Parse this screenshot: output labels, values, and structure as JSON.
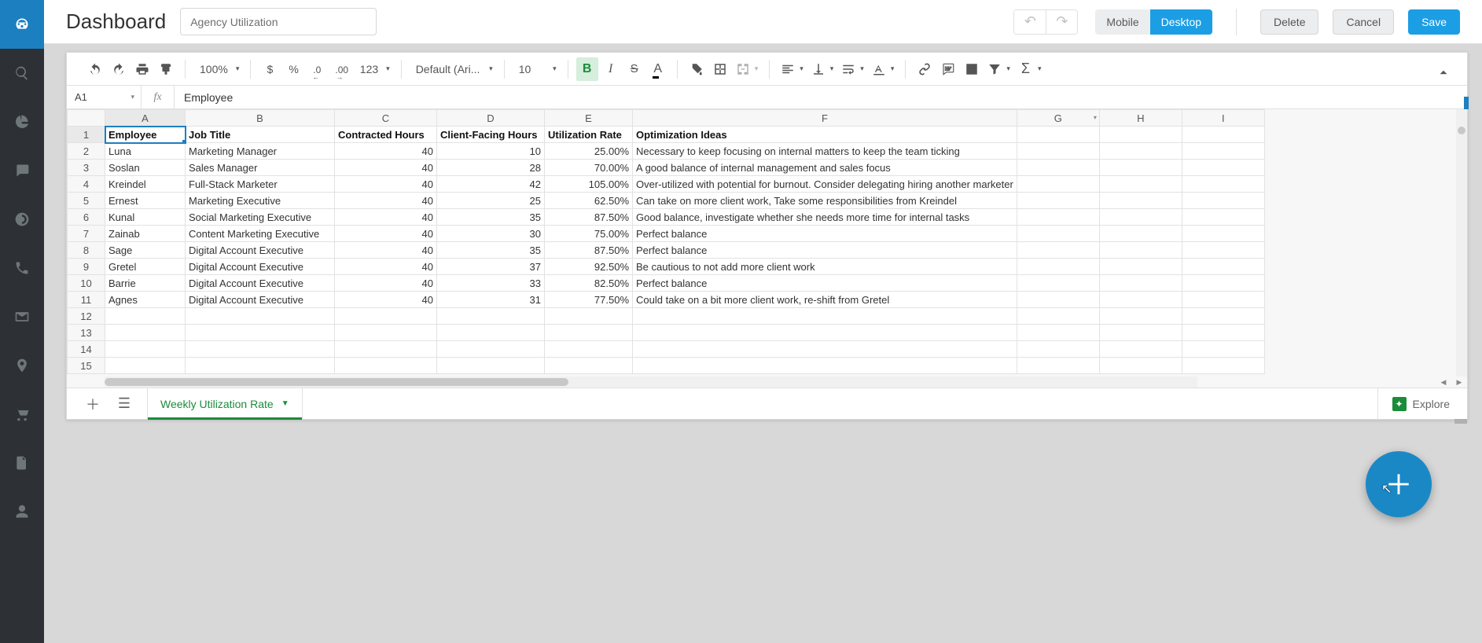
{
  "header": {
    "title": "Dashboard",
    "document_name": "Agency Utilization",
    "device_mobile": "Mobile",
    "device_desktop": "Desktop",
    "delete": "Delete",
    "cancel": "Cancel",
    "save": "Save"
  },
  "toolbar": {
    "zoom": "100%",
    "currency": "$",
    "percent": "%",
    "dec_minus": ".0",
    "dec_plus": ".00",
    "format_num": "123",
    "font": "Default (Ari...",
    "font_size": "10",
    "bold": "B",
    "italic": "I",
    "strike": "S",
    "text_color": "A",
    "sigma": "Σ"
  },
  "formula_bar": {
    "cell_ref": "A1",
    "fx": "fx",
    "value": "Employee"
  },
  "columns": [
    "A",
    "B",
    "C",
    "D",
    "E",
    "F",
    "G",
    "H",
    "I"
  ],
  "row_labels": [
    "1",
    "2",
    "3",
    "4",
    "5",
    "6",
    "7",
    "8",
    "9",
    "10",
    "11",
    "12",
    "13",
    "14",
    "15"
  ],
  "headers": {
    "A": "Employee",
    "B": "Job Title",
    "C": "Contracted Hours",
    "D": "Client-Facing Hours",
    "E": "Utilization Rate",
    "F": "Optimization Ideas"
  },
  "rows": [
    {
      "A": "Luna",
      "B": "Marketing Manager",
      "C": "40",
      "D": "10",
      "E": "25.00%",
      "F": "Necessary to keep focusing on internal matters to keep the team ticking"
    },
    {
      "A": "Soslan",
      "B": "Sales Manager",
      "C": "40",
      "D": "28",
      "E": "70.00%",
      "F": "A good balance of internal management and sales focus"
    },
    {
      "A": "Kreindel",
      "B": "Full-Stack Marketer",
      "C": "40",
      "D": "42",
      "E": "105.00%",
      "F": "Over-utilized with potential for burnout. Consider delegating hiring another marketer"
    },
    {
      "A": "Ernest",
      "B": "Marketing Executive",
      "C": "40",
      "D": "25",
      "E": "62.50%",
      "F": "Can take on more client work, Take some responsibilities from Kreindel"
    },
    {
      "A": "Kunal",
      "B": "Social Marketing Executive",
      "C": "40",
      "D": "35",
      "E": "87.50%",
      "F": "Good balance, investigate whether she needs more time for internal tasks"
    },
    {
      "A": "Zainab",
      "B": "Content Marketing Executive",
      "C": "40",
      "D": "30",
      "E": "75.00%",
      "F": "Perfect balance"
    },
    {
      "A": "Sage",
      "B": "Digital Account Executive",
      "C": "40",
      "D": "35",
      "E": "87.50%",
      "F": "Perfect balance"
    },
    {
      "A": "Gretel",
      "B": "Digital Account Executive",
      "C": "40",
      "D": "37",
      "E": "92.50%",
      "F": "Be cautious to not add more client work"
    },
    {
      "A": "Barrie",
      "B": "Digital Account Executive",
      "C": "40",
      "D": "33",
      "E": "82.50%",
      "F": "Perfect balance"
    },
    {
      "A": "Agnes",
      "B": "Digital Account Executive",
      "C": "40",
      "D": "31",
      "E": "77.50%",
      "F": "Could take on a bit more client work, re-shift from Gretel"
    }
  ],
  "tabs": {
    "sheet_name": "Weekly Utilization Rate",
    "explore": "Explore"
  }
}
